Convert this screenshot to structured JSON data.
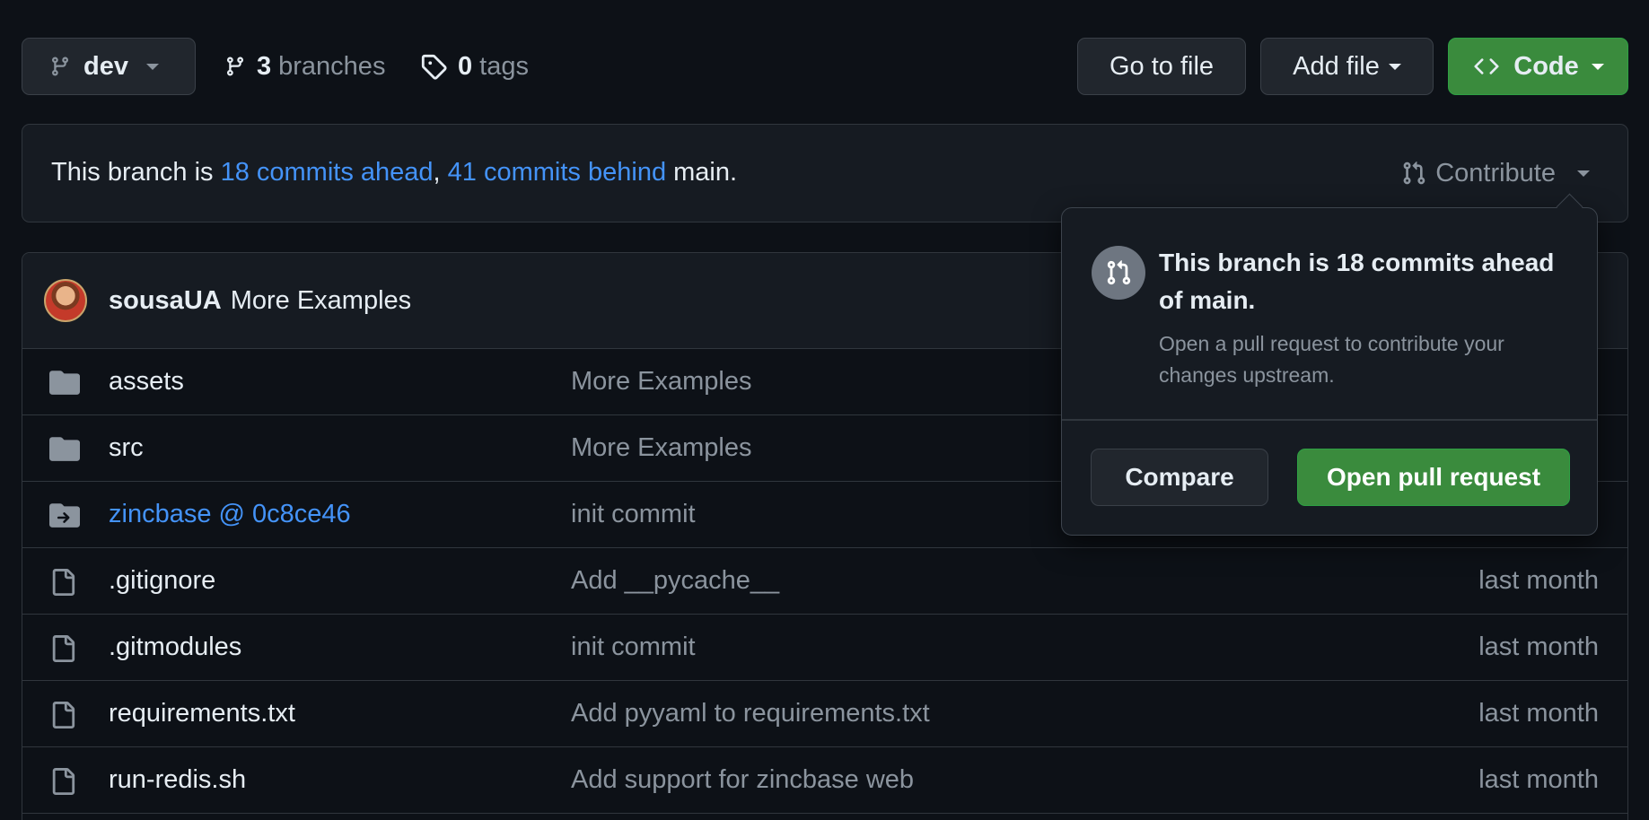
{
  "toolbar": {
    "branch_name": "dev",
    "branches_count": "3",
    "branches_label": "branches",
    "tags_count": "0",
    "tags_label": "tags",
    "goto_file_label": "Go to file",
    "add_file_label": "Add file",
    "code_label": "Code"
  },
  "branch_status": {
    "prefix": "This branch is ",
    "ahead_link": "18 commits ahead",
    "separator": ", ",
    "behind_link": "41 commits behind",
    "suffix": " main.",
    "contribute_label": "Contribute"
  },
  "latest_commit": {
    "author": "sousaUA",
    "message": "More Examples"
  },
  "files": [
    {
      "name": "assets",
      "type": "folder",
      "message": "More Examples",
      "age": ""
    },
    {
      "name": "src",
      "type": "folder",
      "message": "More Examples",
      "age": ""
    },
    {
      "name": "zincbase @ 0c8ce46",
      "type": "submodule",
      "message": "init commit",
      "age": ""
    },
    {
      "name": ".gitignore",
      "type": "file",
      "message": "Add __pycache__",
      "age": "last month"
    },
    {
      "name": ".gitmodules",
      "type": "file",
      "message": "init commit",
      "age": "last month"
    },
    {
      "name": "requirements.txt",
      "type": "file",
      "message": "Add pyyaml to requirements.txt",
      "age": "last month"
    },
    {
      "name": "run-redis.sh",
      "type": "file",
      "message": "Add support for zincbase web",
      "age": "last month"
    }
  ],
  "contribute_popover": {
    "title": "This branch is 18 commits ahead of main.",
    "description": "Open a pull request to contribute your changes upstream.",
    "compare_label": "Compare",
    "open_pr_label": "Open pull request"
  },
  "colors": {
    "background": "#0d1117",
    "link": "#4493f8",
    "code_button": "#3a8b3d",
    "muted_text": "#8b949e"
  }
}
